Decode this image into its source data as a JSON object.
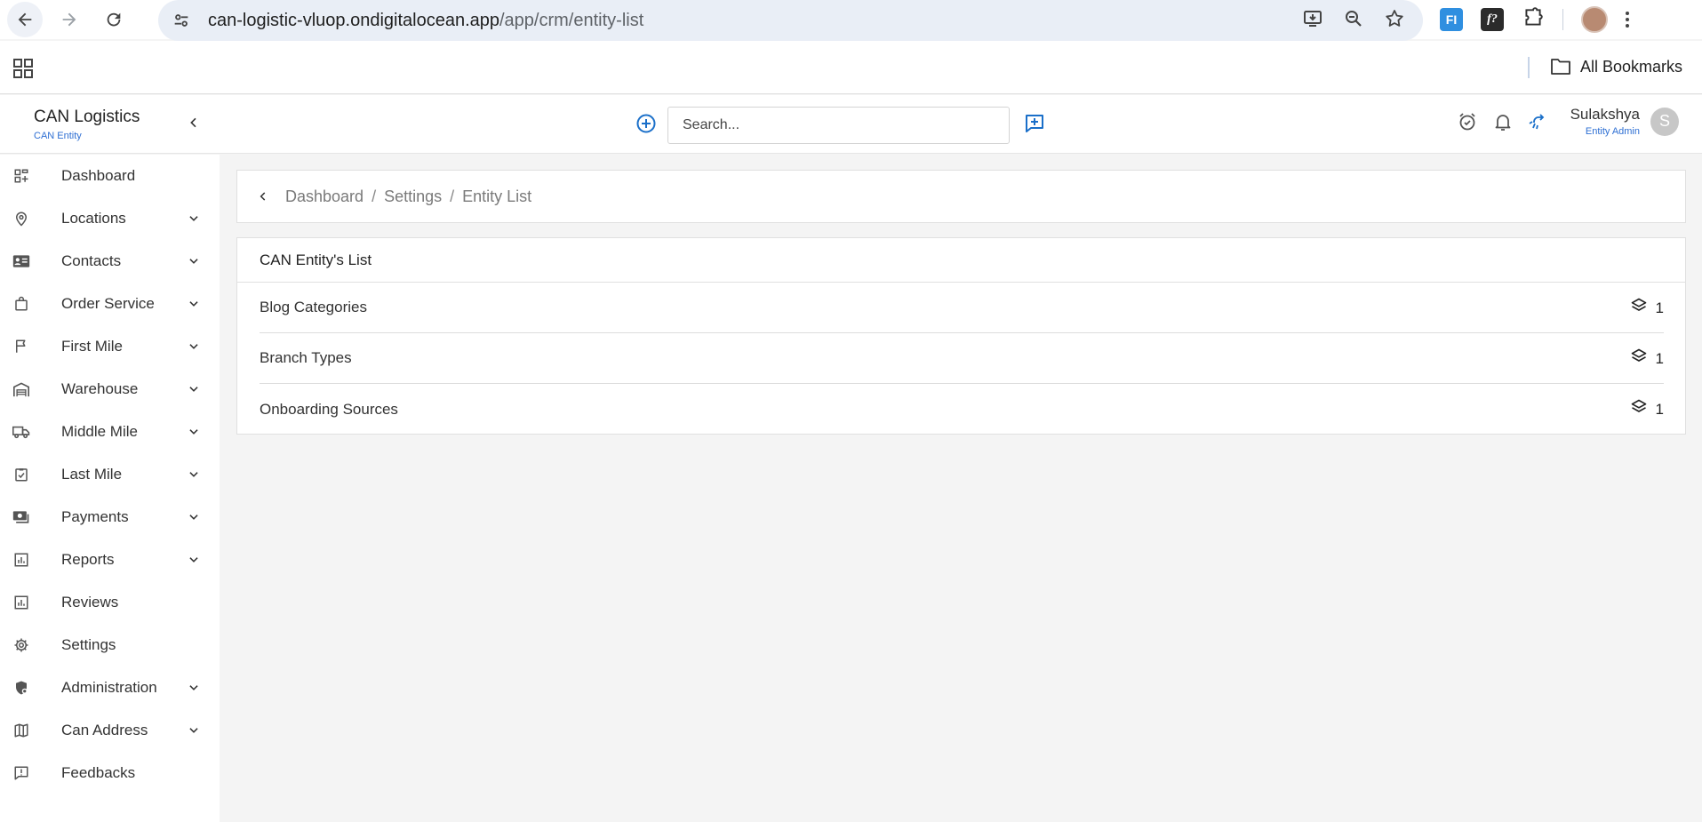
{
  "browser": {
    "url_host": "can-logistic-vluop.ondigitalocean.app",
    "url_path": "/app/crm/entity-list",
    "bookmarks_label": "All Bookmarks"
  },
  "app": {
    "brand_name": "CAN Logistics",
    "brand_sub": "CAN Entity",
    "search_placeholder": "Search...",
    "user_name": "Sulakshya",
    "user_role": "Entity Admin",
    "avatar_initial": "S"
  },
  "sidebar": {
    "items": [
      {
        "label": "Dashboard",
        "icon": "dashboard-icon",
        "has_chevron": false
      },
      {
        "label": "Locations",
        "icon": "location-pin-icon",
        "has_chevron": true
      },
      {
        "label": "Contacts",
        "icon": "contact-card-icon",
        "has_chevron": true
      },
      {
        "label": "Order Service",
        "icon": "shopping-bag-icon",
        "has_chevron": true
      },
      {
        "label": "First Mile",
        "icon": "flag-icon",
        "has_chevron": true
      },
      {
        "label": "Warehouse",
        "icon": "warehouse-icon",
        "has_chevron": true
      },
      {
        "label": "Middle Mile",
        "icon": "truck-icon",
        "has_chevron": true
      },
      {
        "label": "Last Mile",
        "icon": "clipboard-check-icon",
        "has_chevron": true
      },
      {
        "label": "Payments",
        "icon": "payments-icon",
        "has_chevron": true
      },
      {
        "label": "Reports",
        "icon": "bar-chart-icon",
        "has_chevron": true
      },
      {
        "label": "Reviews",
        "icon": "bar-chart-icon",
        "has_chevron": false
      },
      {
        "label": "Settings",
        "icon": "gear-icon",
        "has_chevron": false
      },
      {
        "label": "Administration",
        "icon": "shield-icon",
        "has_chevron": true
      },
      {
        "label": "Can Address",
        "icon": "map-icon",
        "has_chevron": true
      },
      {
        "label": "Feedbacks",
        "icon": "feedback-icon",
        "has_chevron": false
      }
    ]
  },
  "breadcrumb": {
    "items": [
      "Dashboard",
      "Settings",
      "Entity List"
    ],
    "separator": "/"
  },
  "entity_list": {
    "title": "CAN Entity's List",
    "rows": [
      {
        "label": "Blog Categories",
        "count": "1"
      },
      {
        "label": "Branch Types",
        "count": "1"
      },
      {
        "label": "Onboarding Sources",
        "count": "1"
      }
    ]
  },
  "colors": {
    "accent": "#1a6fc9",
    "sub_text": "#2e6fd3",
    "background": "#f4f4f4"
  }
}
